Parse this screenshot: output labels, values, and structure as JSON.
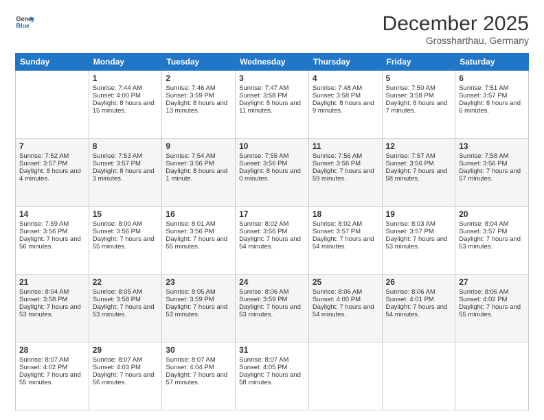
{
  "logo": {
    "line1": "General",
    "line2": "Blue"
  },
  "header": {
    "month": "December 2025",
    "location": "Grossharthau, Germany"
  },
  "weekdays": [
    "Sunday",
    "Monday",
    "Tuesday",
    "Wednesday",
    "Thursday",
    "Friday",
    "Saturday"
  ],
  "weeks": [
    [
      {
        "day": "",
        "sunrise": "",
        "sunset": "",
        "daylight": ""
      },
      {
        "day": "1",
        "sunrise": "Sunrise: 7:44 AM",
        "sunset": "Sunset: 4:00 PM",
        "daylight": "Daylight: 8 hours and 15 minutes."
      },
      {
        "day": "2",
        "sunrise": "Sunrise: 7:46 AM",
        "sunset": "Sunset: 3:59 PM",
        "daylight": "Daylight: 8 hours and 13 minutes."
      },
      {
        "day": "3",
        "sunrise": "Sunrise: 7:47 AM",
        "sunset": "Sunset: 3:58 PM",
        "daylight": "Daylight: 8 hours and 11 minutes."
      },
      {
        "day": "4",
        "sunrise": "Sunrise: 7:48 AM",
        "sunset": "Sunset: 3:58 PM",
        "daylight": "Daylight: 8 hours and 9 minutes."
      },
      {
        "day": "5",
        "sunrise": "Sunrise: 7:50 AM",
        "sunset": "Sunset: 3:58 PM",
        "daylight": "Daylight: 8 hours and 7 minutes."
      },
      {
        "day": "6",
        "sunrise": "Sunrise: 7:51 AM",
        "sunset": "Sunset: 3:57 PM",
        "daylight": "Daylight: 8 hours and 6 minutes."
      }
    ],
    [
      {
        "day": "7",
        "sunrise": "Sunrise: 7:52 AM",
        "sunset": "Sunset: 3:57 PM",
        "daylight": "Daylight: 8 hours and 4 minutes."
      },
      {
        "day": "8",
        "sunrise": "Sunrise: 7:53 AM",
        "sunset": "Sunset: 3:57 PM",
        "daylight": "Daylight: 8 hours and 3 minutes."
      },
      {
        "day": "9",
        "sunrise": "Sunrise: 7:54 AM",
        "sunset": "Sunset: 3:56 PM",
        "daylight": "Daylight: 8 hours and 1 minute."
      },
      {
        "day": "10",
        "sunrise": "Sunrise: 7:55 AM",
        "sunset": "Sunset: 3:56 PM",
        "daylight": "Daylight: 8 hours and 0 minutes."
      },
      {
        "day": "11",
        "sunrise": "Sunrise: 7:56 AM",
        "sunset": "Sunset: 3:56 PM",
        "daylight": "Daylight: 7 hours and 59 minutes."
      },
      {
        "day": "12",
        "sunrise": "Sunrise: 7:57 AM",
        "sunset": "Sunset: 3:56 PM",
        "daylight": "Daylight: 7 hours and 58 minutes."
      },
      {
        "day": "13",
        "sunrise": "Sunrise: 7:58 AM",
        "sunset": "Sunset: 3:56 PM",
        "daylight": "Daylight: 7 hours and 57 minutes."
      }
    ],
    [
      {
        "day": "14",
        "sunrise": "Sunrise: 7:59 AM",
        "sunset": "Sunset: 3:56 PM",
        "daylight": "Daylight: 7 hours and 56 minutes."
      },
      {
        "day": "15",
        "sunrise": "Sunrise: 8:00 AM",
        "sunset": "Sunset: 3:56 PM",
        "daylight": "Daylight: 7 hours and 55 minutes."
      },
      {
        "day": "16",
        "sunrise": "Sunrise: 8:01 AM",
        "sunset": "Sunset: 3:56 PM",
        "daylight": "Daylight: 7 hours and 55 minutes."
      },
      {
        "day": "17",
        "sunrise": "Sunrise: 8:02 AM",
        "sunset": "Sunset: 3:56 PM",
        "daylight": "Daylight: 7 hours and 54 minutes."
      },
      {
        "day": "18",
        "sunrise": "Sunrise: 8:02 AM",
        "sunset": "Sunset: 3:57 PM",
        "daylight": "Daylight: 7 hours and 54 minutes."
      },
      {
        "day": "19",
        "sunrise": "Sunrise: 8:03 AM",
        "sunset": "Sunset: 3:57 PM",
        "daylight": "Daylight: 7 hours and 53 minutes."
      },
      {
        "day": "20",
        "sunrise": "Sunrise: 8:04 AM",
        "sunset": "Sunset: 3:57 PM",
        "daylight": "Daylight: 7 hours and 53 minutes."
      }
    ],
    [
      {
        "day": "21",
        "sunrise": "Sunrise: 8:04 AM",
        "sunset": "Sunset: 3:58 PM",
        "daylight": "Daylight: 7 hours and 53 minutes."
      },
      {
        "day": "22",
        "sunrise": "Sunrise: 8:05 AM",
        "sunset": "Sunset: 3:58 PM",
        "daylight": "Daylight: 7 hours and 53 minutes."
      },
      {
        "day": "23",
        "sunrise": "Sunrise: 8:05 AM",
        "sunset": "Sunset: 3:59 PM",
        "daylight": "Daylight: 7 hours and 53 minutes."
      },
      {
        "day": "24",
        "sunrise": "Sunrise: 8:06 AM",
        "sunset": "Sunset: 3:59 PM",
        "daylight": "Daylight: 7 hours and 53 minutes."
      },
      {
        "day": "25",
        "sunrise": "Sunrise: 8:06 AM",
        "sunset": "Sunset: 4:00 PM",
        "daylight": "Daylight: 7 hours and 54 minutes."
      },
      {
        "day": "26",
        "sunrise": "Sunrise: 8:06 AM",
        "sunset": "Sunset: 4:01 PM",
        "daylight": "Daylight: 7 hours and 54 minutes."
      },
      {
        "day": "27",
        "sunrise": "Sunrise: 8:06 AM",
        "sunset": "Sunset: 4:02 PM",
        "daylight": "Daylight: 7 hours and 55 minutes."
      }
    ],
    [
      {
        "day": "28",
        "sunrise": "Sunrise: 8:07 AM",
        "sunset": "Sunset: 4:02 PM",
        "daylight": "Daylight: 7 hours and 55 minutes."
      },
      {
        "day": "29",
        "sunrise": "Sunrise: 8:07 AM",
        "sunset": "Sunset: 4:03 PM",
        "daylight": "Daylight: 7 hours and 56 minutes."
      },
      {
        "day": "30",
        "sunrise": "Sunrise: 8:07 AM",
        "sunset": "Sunset: 4:04 PM",
        "daylight": "Daylight: 7 hours and 57 minutes."
      },
      {
        "day": "31",
        "sunrise": "Sunrise: 8:07 AM",
        "sunset": "Sunset: 4:05 PM",
        "daylight": "Daylight: 7 hours and 58 minutes."
      },
      {
        "day": "",
        "sunrise": "",
        "sunset": "",
        "daylight": ""
      },
      {
        "day": "",
        "sunrise": "",
        "sunset": "",
        "daylight": ""
      },
      {
        "day": "",
        "sunrise": "",
        "sunset": "",
        "daylight": ""
      }
    ]
  ]
}
